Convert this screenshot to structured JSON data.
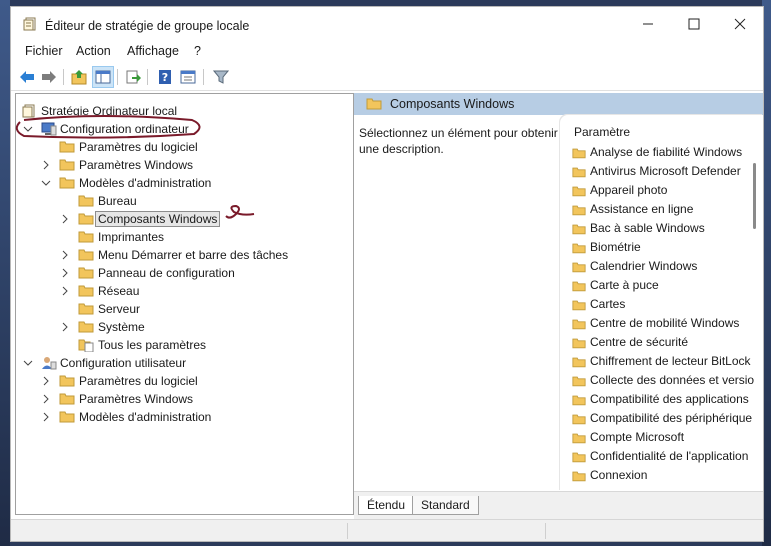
{
  "window": {
    "title": "Éditeur de stratégie de groupe locale",
    "minimize_icon": "minimize-icon",
    "maximize_icon": "maximize-icon",
    "close_icon": "close-icon"
  },
  "menu": [
    "Fichier",
    "Action",
    "Affichage",
    "?"
  ],
  "toolbar": {
    "icons": [
      "back-arrow-icon",
      "forward-arrow-icon",
      "up-folder-icon",
      "show-hide-tree-icon",
      "export-list-icon",
      "help-icon",
      "properties-icon",
      "filter-icon"
    ]
  },
  "tree": {
    "root": "Stratégie Ordinateur local",
    "computer_config": "Configuration ordinateur",
    "software_settings": "Paramètres du logiciel",
    "windows_settings": "Paramètres Windows",
    "admin_templates": "Modèles d'administration",
    "desktop": "Bureau",
    "windows_components": "Composants Windows",
    "printers": "Imprimantes",
    "start_menu": "Menu Démarrer et barre des tâches",
    "control_panel": "Panneau de configuration",
    "network": "Réseau",
    "server": "Serveur",
    "system": "Système",
    "all_settings": "Tous les paramètres",
    "user_config": "Configuration utilisateur",
    "user_software_settings": "Paramètres du logiciel",
    "user_windows_settings": "Paramètres Windows",
    "user_admin_templates": "Modèles d'administration"
  },
  "details": {
    "header": "Composants Windows",
    "description": "Sélectionnez un élément pour obtenir une description.",
    "column_header": "Paramètre",
    "items": [
      "Analyse de fiabilité Windows",
      "Antivirus Microsoft Defender",
      "Appareil photo",
      "Assistance en ligne",
      "Bac à sable Windows",
      "Biométrie",
      "Calendrier Windows",
      "Carte à puce",
      "Cartes",
      "Centre de mobilité Windows",
      "Centre de sécurité",
      "Chiffrement de lecteur BitLock",
      "Collecte des données et versio",
      "Compatibilité des applications",
      "Compatibilité des périphérique",
      "Compte Microsoft",
      "Confidentialité de l'application",
      "Connexion"
    ]
  },
  "tabs": [
    "Étendu",
    "Standard"
  ],
  "colors": {
    "header_blue": "#b7cde4",
    "folder_yellow": "#f2c55c",
    "annotation_red": "#7a1a2a"
  }
}
